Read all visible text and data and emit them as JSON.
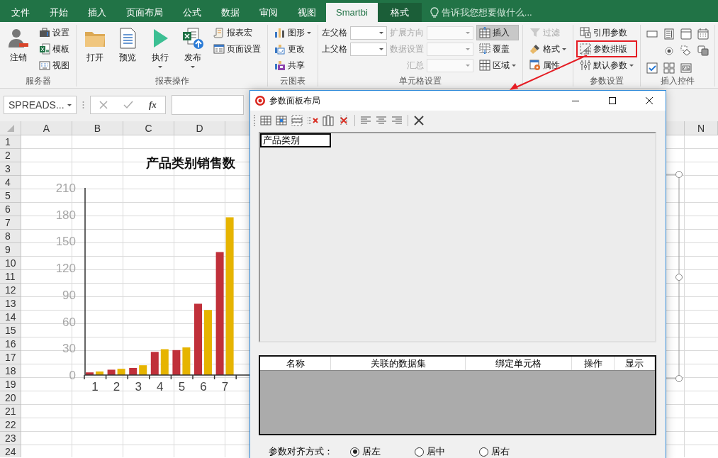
{
  "ribbon": {
    "tabs": [
      {
        "label": "文件",
        "selected": false,
        "contextual": false
      },
      {
        "label": "开始",
        "selected": false,
        "contextual": false
      },
      {
        "label": "插入",
        "selected": false,
        "contextual": false
      },
      {
        "label": "页面布局",
        "selected": false,
        "contextual": false
      },
      {
        "label": "公式",
        "selected": false,
        "contextual": false
      },
      {
        "label": "数据",
        "selected": false,
        "contextual": false
      },
      {
        "label": "审阅",
        "selected": false,
        "contextual": false
      },
      {
        "label": "视图",
        "selected": false,
        "contextual": false
      },
      {
        "label": "Smartbi",
        "selected": true,
        "contextual": false
      },
      {
        "label": "格式",
        "selected": false,
        "contextual": true
      }
    ],
    "tell_me": {
      "placeholder": "告诉我您想要做什么..."
    },
    "groups": [
      {
        "kind": "buttons",
        "label": "服务器",
        "columns": [
          [
            {
              "kind": "large",
              "label": "注销",
              "disabled": false,
              "dropdown": false,
              "pressed": false,
              "annotated": false
            }
          ],
          [
            {
              "kind": "small",
              "label": "设置",
              "disabled": false,
              "dropdown": false,
              "pressed": false,
              "annotated": false
            },
            {
              "kind": "small",
              "label": "模板",
              "disabled": false,
              "dropdown": false,
              "pressed": false,
              "annotated": false
            },
            {
              "kind": "small",
              "label": "视图",
              "disabled": false,
              "dropdown": false,
              "pressed": false,
              "annotated": false
            }
          ]
        ]
      },
      {
        "kind": "buttons",
        "label": "报表操作",
        "columns": [
          [
            {
              "kind": "large",
              "label": "打开",
              "disabled": false,
              "dropdown": false,
              "pressed": false,
              "annotated": false
            }
          ],
          [
            {
              "kind": "large",
              "label": "预览",
              "disabled": false,
              "dropdown": false,
              "pressed": false,
              "annotated": false
            }
          ],
          [
            {
              "kind": "large",
              "label": "执行",
              "disabled": false,
              "dropdown": true,
              "pressed": false,
              "annotated": false
            }
          ],
          [
            {
              "kind": "large",
              "label": "发布",
              "disabled": false,
              "dropdown": true,
              "pressed": false,
              "annotated": false
            }
          ],
          [
            {
              "kind": "small",
              "label": "报表宏",
              "disabled": false,
              "dropdown": false,
              "pressed": false,
              "annotated": false
            },
            {
              "kind": "small",
              "label": "页面设置",
              "disabled": false,
              "dropdown": false,
              "pressed": false,
              "annotated": false
            }
          ]
        ]
      },
      {
        "kind": "buttons",
        "label": "云图表",
        "columns": [
          [
            {
              "kind": "small",
              "label": "图形",
              "disabled": false,
              "dropdown": true,
              "pressed": false,
              "annotated": false
            },
            {
              "kind": "small",
              "label": "更改",
              "disabled": false,
              "dropdown": false,
              "pressed": false,
              "annotated": false
            },
            {
              "kind": "small",
              "label": "共享",
              "disabled": false,
              "dropdown": false,
              "pressed": false,
              "annotated": false
            }
          ]
        ]
      },
      {
        "kind": "buttons",
        "label": "单元格设置",
        "columns": [
          [
            {
              "kind": "combo",
              "label": "左父格",
              "disabled": false
            },
            {
              "kind": "combo",
              "label": "上父格",
              "disabled": false
            }
          ],
          [
            {
              "kind": "combo",
              "label": "扩展方向",
              "disabled": true
            },
            {
              "kind": "combo",
              "label": "数据设置",
              "disabled": true
            },
            {
              "kind": "combo",
              "label": "汇总",
              "disabled": true
            }
          ],
          [
            {
              "kind": "small",
              "label": "插入",
              "disabled": false,
              "dropdown": false,
              "pressed": true,
              "annotated": false
            },
            {
              "kind": "small",
              "label": "覆盖",
              "disabled": false,
              "dropdown": false,
              "pressed": false,
              "annotated": false
            },
            {
              "kind": "small",
              "label": "区域",
              "disabled": false,
              "dropdown": true,
              "pressed": false,
              "annotated": false
            }
          ]
        ]
      },
      {
        "kind": "buttons",
        "columns": [
          [
            {
              "kind": "small",
              "label": "过滤",
              "disabled": true,
              "dropdown": false,
              "pressed": false,
              "annotated": false
            },
            {
              "kind": "small",
              "label": "格式",
              "disabled": false,
              "dropdown": true,
              "pressed": false,
              "annotated": false
            },
            {
              "kind": "small",
              "label": "属性",
              "disabled": false,
              "dropdown": false,
              "pressed": false,
              "annotated": false
            }
          ]
        ]
      },
      {
        "kind": "buttons",
        "label": "参数设置",
        "columns": [
          [
            {
              "kind": "small",
              "label": "引用参数",
              "disabled": false,
              "dropdown": false,
              "pressed": false,
              "annotated": false
            },
            {
              "kind": "small",
              "label": "参数排版",
              "disabled": false,
              "dropdown": false,
              "pressed": false,
              "annotated": true
            },
            {
              "kind": "small",
              "label": "默认参数",
              "disabled": false,
              "dropdown": true,
              "pressed": false,
              "annotated": false
            }
          ]
        ]
      },
      {
        "kind": "controls",
        "label": "插入控件"
      }
    ]
  },
  "formula_bar": {
    "name_box": "SPREADS...",
    "function_label": "fx"
  },
  "sheet": {
    "columns": [
      "A",
      "B",
      "C",
      "D",
      "N"
    ],
    "rows": [
      "1",
      "2",
      "3",
      "4",
      "5",
      "6",
      "7",
      "8",
      "9",
      "10",
      "11",
      "12",
      "13",
      "14",
      "15",
      "16",
      "17",
      "18",
      "19",
      "20",
      "21",
      "22",
      "23",
      "24"
    ],
    "chart_data": {
      "type": "bar",
      "title": "产品类别销售数",
      "categories": [
        "1",
        "2",
        "3",
        "4",
        "5",
        "6",
        "7"
      ],
      "series": [
        {
          "color": "#c0303a",
          "values": [
            3,
            6,
            8,
            26,
            28,
            80,
            138
          ]
        },
        {
          "color": "#e6b400",
          "values": [
            4,
            7,
            11,
            29,
            31,
            73,
            177
          ]
        }
      ],
      "ylim": [
        0,
        210
      ],
      "yticks": [
        0,
        30,
        60,
        90,
        120,
        150,
        180,
        210
      ]
    }
  },
  "dialog": {
    "title": "参数面板布局",
    "layout_cells": [
      {
        "label": "产品类别"
      }
    ],
    "table": {
      "columns": [
        "名称",
        "关联的数据集",
        "绑定单元格",
        "操作",
        "显示"
      ]
    },
    "alignment": {
      "label": "参数对齐方式：",
      "options": [
        {
          "label": "居左",
          "selected": true
        },
        {
          "label": "居中",
          "selected": false
        },
        {
          "label": "居右",
          "selected": false
        }
      ]
    }
  }
}
